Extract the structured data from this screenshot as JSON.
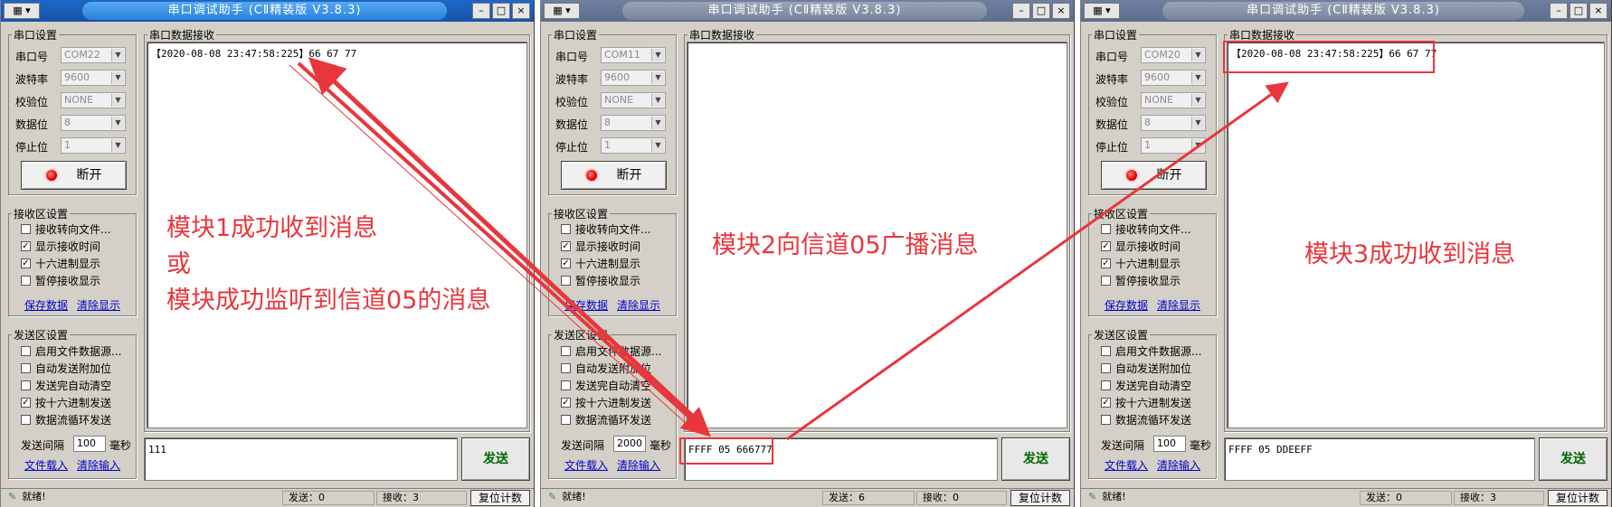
{
  "windows": [
    {
      "title": "串口调试助手 (CⅡ精装版 V3.8.3)",
      "active": true,
      "port_settings": {
        "title": "串口设置",
        "rows": [
          {
            "label": "串口号",
            "value": "COM22"
          },
          {
            "label": "波特率",
            "value": "9600"
          },
          {
            "label": "校验位",
            "value": "NONE"
          },
          {
            "label": "数据位",
            "value": "8"
          },
          {
            "label": "停止位",
            "value": "1"
          }
        ],
        "open_button": "断开"
      },
      "recv_settings": {
        "title": "接收区设置",
        "options": [
          {
            "label": "接收转向文件...",
            "checked": false
          },
          {
            "label": "显示接收时间",
            "checked": true
          },
          {
            "label": "十六进制显示",
            "checked": true
          },
          {
            "label": "暂停接收显示",
            "checked": false
          }
        ],
        "save_link": "保存数据",
        "clear_link": "清除显示"
      },
      "send_settings": {
        "title": "发送区设置",
        "options": [
          {
            "label": "启用文件数据源...",
            "checked": false
          },
          {
            "label": "自动发送附加位",
            "checked": false
          },
          {
            "label": "发送完自动清空",
            "checked": false
          },
          {
            "label": "按十六进制发送",
            "checked": true
          },
          {
            "label": "数据流循环发送",
            "checked": false
          }
        ],
        "interval_label": "发送间隔",
        "interval_value": "100",
        "interval_unit": "毫秒",
        "load_link": "文件载入",
        "clear_input_link": "清除输入"
      },
      "receive_title": "串口数据接收",
      "receive_text": "【2020-08-08 23:47:58:225】66 67 77",
      "send_text": "111",
      "send_button": "发送",
      "status": {
        "ready": "就绪!",
        "sent": "发送：0",
        "received": "接收：3",
        "reset": "复位计数"
      }
    },
    {
      "title": "串口调试助手 (CⅡ精装版 V3.8.3)",
      "active": false,
      "port_settings": {
        "title": "串口设置",
        "rows": [
          {
            "label": "串口号",
            "value": "COM11"
          },
          {
            "label": "波特率",
            "value": "9600"
          },
          {
            "label": "校验位",
            "value": "NONE"
          },
          {
            "label": "数据位",
            "value": "8"
          },
          {
            "label": "停止位",
            "value": "1"
          }
        ],
        "open_button": "断开"
      },
      "recv_settings": {
        "title": "接收区设置",
        "options": [
          {
            "label": "接收转向文件...",
            "checked": false
          },
          {
            "label": "显示接收时间",
            "checked": true
          },
          {
            "label": "十六进制显示",
            "checked": true
          },
          {
            "label": "暂停接收显示",
            "checked": false
          }
        ],
        "save_link": "保存数据",
        "clear_link": "清除显示"
      },
      "send_settings": {
        "title": "发送区设置",
        "options": [
          {
            "label": "启用文件数据源...",
            "checked": false
          },
          {
            "label": "自动发送附加位",
            "checked": false
          },
          {
            "label": "发送完自动清空",
            "checked": false
          },
          {
            "label": "按十六进制发送",
            "checked": true
          },
          {
            "label": "数据流循环发送",
            "checked": false
          }
        ],
        "interval_label": "发送间隔",
        "interval_value": "2000",
        "interval_unit": "毫秒",
        "load_link": "文件载入",
        "clear_input_link": "清除输入"
      },
      "receive_title": "串口数据接收",
      "receive_text": "",
      "send_text": "FFFF 05 666777",
      "send_button": "发送",
      "status": {
        "ready": "就绪!",
        "sent": "发送：6",
        "received": "接收：0",
        "reset": "复位计数"
      }
    },
    {
      "title": "串口调试助手 (CⅡ精装版 V3.8.3)",
      "active": false,
      "port_settings": {
        "title": "串口设置",
        "rows": [
          {
            "label": "串口号",
            "value": "COM20"
          },
          {
            "label": "波特率",
            "value": "9600"
          },
          {
            "label": "校验位",
            "value": "NONE"
          },
          {
            "label": "数据位",
            "value": "8"
          },
          {
            "label": "停止位",
            "value": "1"
          }
        ],
        "open_button": "断开"
      },
      "recv_settings": {
        "title": "接收区设置",
        "options": [
          {
            "label": "接收转向文件...",
            "checked": false
          },
          {
            "label": "显示接收时间",
            "checked": true
          },
          {
            "label": "十六进制显示",
            "checked": true
          },
          {
            "label": "暂停接收显示",
            "checked": false
          }
        ],
        "save_link": "保存数据",
        "clear_link": "清除显示"
      },
      "send_settings": {
        "title": "发送区设置",
        "options": [
          {
            "label": "启用文件数据源...",
            "checked": false
          },
          {
            "label": "自动发送附加位",
            "checked": false
          },
          {
            "label": "发送完自动清空",
            "checked": false
          },
          {
            "label": "按十六进制发送",
            "checked": true
          },
          {
            "label": "数据流循环发送",
            "checked": false
          }
        ],
        "interval_label": "发送间隔",
        "interval_value": "100",
        "interval_unit": "毫秒",
        "load_link": "文件载入",
        "clear_input_link": "清除输入"
      },
      "receive_title": "串口数据接收",
      "receive_text": "【2020-08-08 23:47:58:225】66 67 77",
      "send_text": "FFFF 05 DDEEFF",
      "send_button": "发送",
      "status": {
        "ready": "就绪!",
        "sent": "发送：0",
        "received": "接收：3",
        "reset": "复位计数"
      }
    }
  ],
  "annotations": {
    "module1_line1": "模块1成功收到消息",
    "module1_line2": "或",
    "module1_line3": "模块成功监听到信道05的消息",
    "module2": "模块2向信道05广播消息",
    "module3": "模块3成功收到消息"
  },
  "colors": {
    "annotation": "#e8363c",
    "send_button_text": "#006400",
    "link": "#0000cc"
  }
}
